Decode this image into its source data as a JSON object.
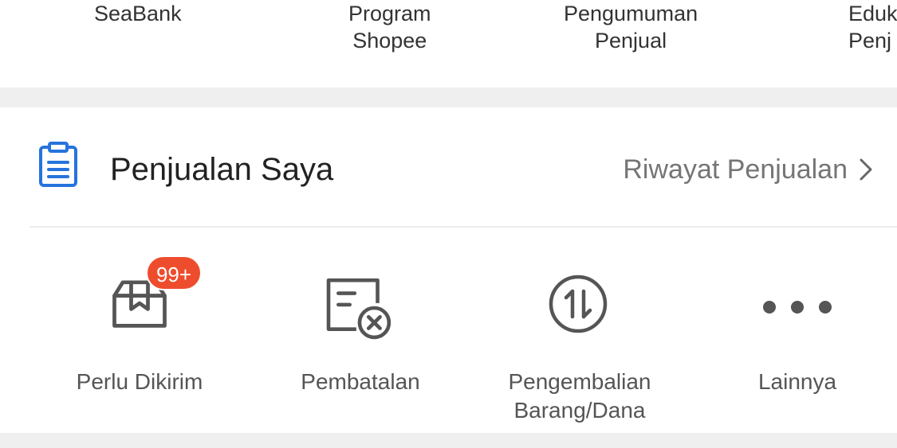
{
  "shortcuts": [
    {
      "line1": "SeaBank",
      "line2": ""
    },
    {
      "line1": "Program",
      "line2": "Shopee"
    },
    {
      "line1": "Pengumuman",
      "line2": "Penjual"
    },
    {
      "line1": "Eduk",
      "line2": "Penj"
    }
  ],
  "section": {
    "icon": "clipboard-icon",
    "title": "Penjualan Saya",
    "history_label": "Riwayat Penjualan",
    "history_icon": "chevron-right-icon",
    "accent_color": "#2673dd"
  },
  "actions": [
    {
      "icon": "package-icon",
      "line1": "Perlu Dikirim",
      "line2": "",
      "badge": "99+"
    },
    {
      "icon": "cancel-document-icon",
      "line1": "Pembatalan",
      "line2": ""
    },
    {
      "icon": "return-arrows-icon",
      "line1": "Pengembalian",
      "line2": "Barang/Dana"
    },
    {
      "icon": "more-dots-icon",
      "line1": "Lainnya",
      "line2": ""
    }
  ],
  "colors": {
    "badge": "#ee4d2d",
    "icon_gray": "#555555",
    "separator": "#efefef"
  }
}
